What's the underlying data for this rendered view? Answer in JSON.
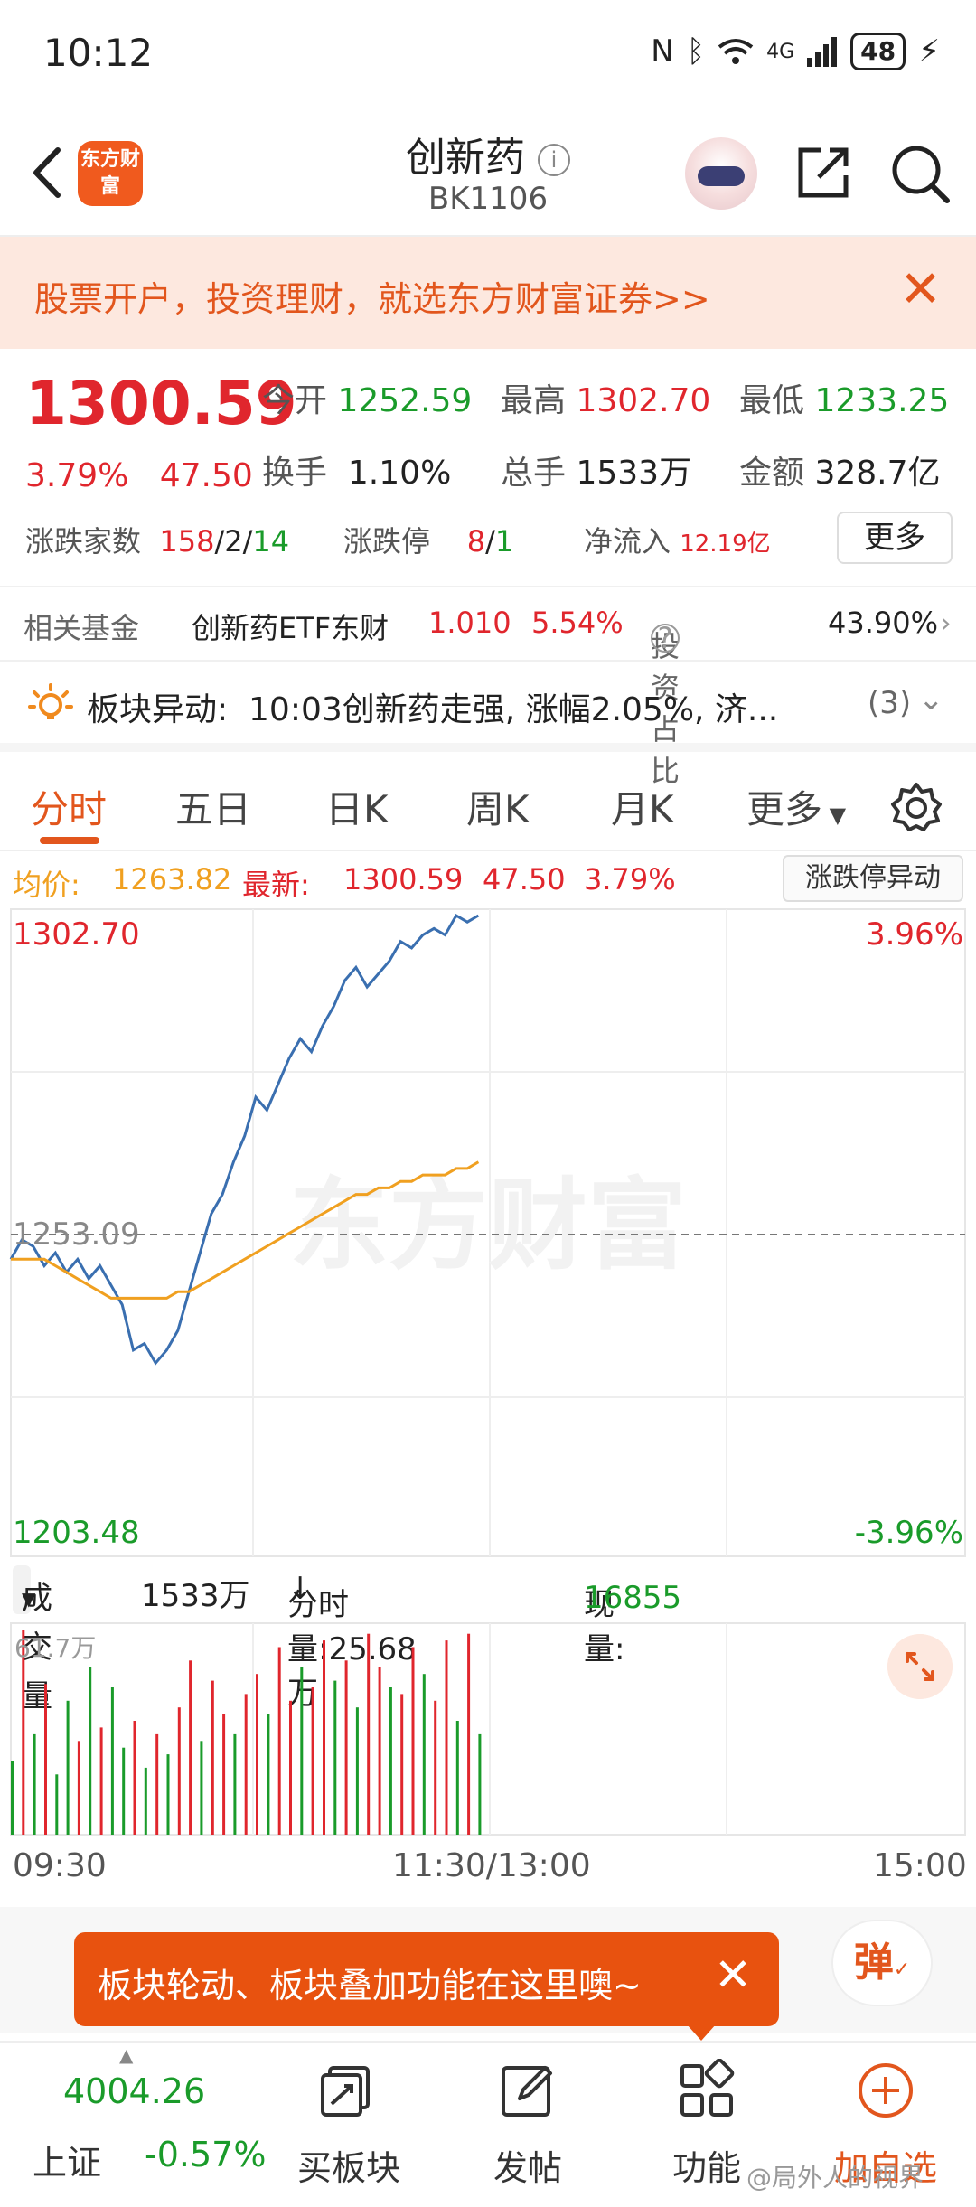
{
  "status_bar": {
    "time": "10:12",
    "network": "4G",
    "battery": "48"
  },
  "header": {
    "title": "创新药",
    "code": "BK1106",
    "logo_text": "东方财富"
  },
  "banner": {
    "text": "股票开户，投资理财，就选东方财富证券>>"
  },
  "quote": {
    "price": "1300.59",
    "change_pct": "3.79%",
    "change": "47.50",
    "open_label": "今开",
    "open": "1252.59",
    "high_label": "最高",
    "high": "1302.70",
    "low_label": "最低",
    "low": "1233.25",
    "turnover_label": "换手",
    "turnover": "1.10%",
    "volume_label": "总手",
    "volume": "1533万",
    "amount_label": "金额",
    "amount": "328.7亿",
    "breadth_label": "涨跌家数",
    "breadth_up": "158",
    "breadth_flat": "2",
    "breadth_down": "14",
    "limit_label": "涨跌停",
    "limit_up": "8",
    "limit_down": "1",
    "netflow_label": "净流入",
    "netflow": "12.19亿",
    "more_label": "更多"
  },
  "fund": {
    "label": "相关基金",
    "name": "创新药ETF东财",
    "price": "1.010",
    "change": "5.54%",
    "ratio_label": "投资占比",
    "ratio": "43.90%"
  },
  "news": {
    "label": "板块异动:",
    "text": "10:03创新药走强, 涨幅2.05%, 济...",
    "count": "(3)"
  },
  "tabs": [
    "分时",
    "五日",
    "日K",
    "周K",
    "月K",
    "更多"
  ],
  "info_row": {
    "avg_label": "均价:",
    "avg": "1263.82",
    "last_label": "最新:",
    "last": "1300.59",
    "change": "47.50",
    "change_pct": "3.79%",
    "button": "涨跌停异动"
  },
  "chart_data": {
    "type": "line",
    "x": [
      "09:30",
      "09:31",
      "09:32",
      "09:33",
      "09:34",
      "09:35",
      "09:36",
      "09:37",
      "09:38",
      "09:39",
      "09:40",
      "09:41",
      "09:42",
      "09:43",
      "09:44",
      "09:45",
      "09:46",
      "09:47",
      "09:48",
      "09:49",
      "09:50",
      "09:51",
      "09:52",
      "09:53",
      "09:54",
      "09:55",
      "09:56",
      "09:57",
      "09:58",
      "09:59",
      "10:00",
      "10:01",
      "10:02",
      "10:03",
      "10:04",
      "10:05",
      "10:06",
      "10:07",
      "10:08",
      "10:09",
      "10:10",
      "10:11",
      "10:12"
    ],
    "series": [
      {
        "name": "最新",
        "values": [
          1249,
          1252,
          1251,
          1248,
          1250,
          1247,
          1249,
          1246,
          1248,
          1245,
          1242,
          1235,
          1236,
          1233,
          1235,
          1238,
          1244,
          1250,
          1256,
          1259,
          1264,
          1268,
          1274,
          1272,
          1276,
          1280,
          1283,
          1281,
          1285,
          1288,
          1292,
          1294,
          1291,
          1293,
          1295,
          1298,
          1297,
          1299,
          1300,
          1299,
          1302,
          1301,
          1302
        ]
      },
      {
        "name": "均价",
        "values": [
          1249,
          1249,
          1249,
          1249,
          1248,
          1247,
          1246,
          1245,
          1244,
          1243,
          1243,
          1243,
          1243,
          1243,
          1243,
          1244,
          1244,
          1245,
          1246,
          1247,
          1248,
          1249,
          1250,
          1251,
          1252,
          1253,
          1254,
          1255,
          1256,
          1257,
          1258,
          1259,
          1259,
          1260,
          1260,
          1261,
          1261,
          1262,
          1262,
          1262,
          1263,
          1263,
          1264
        ]
      }
    ],
    "volume": [
      22,
      61,
      30,
      45,
      18,
      40,
      28,
      50,
      32,
      44,
      26,
      34,
      20,
      30,
      24,
      38,
      52,
      28,
      46,
      36,
      30,
      42,
      48,
      36,
      56,
      40,
      50,
      44,
      58,
      46,
      52,
      38,
      60,
      50,
      44,
      42,
      56,
      48,
      40,
      58,
      34,
      60,
      30
    ],
    "volume_colors": [
      "green",
      "red",
      "green",
      "red",
      "green",
      "green",
      "red",
      "green",
      "red",
      "green",
      "green",
      "red",
      "green",
      "red",
      "green",
      "red",
      "red",
      "green",
      "red",
      "red",
      "green",
      "red",
      "red",
      "green",
      "red",
      "red",
      "green",
      "red",
      "red",
      "green",
      "red",
      "green",
      "red",
      "red",
      "green",
      "red",
      "red",
      "green",
      "red",
      "red",
      "green",
      "red",
      "green"
    ],
    "ylim": [
      1203.48,
      1302.7
    ],
    "ref_price": "1253.09",
    "y_top_label": "1302.70",
    "y_bottom_label": "1203.48",
    "pct_top_label": "3.96%",
    "pct_bottom_label": "-3.96%",
    "x_labels": [
      "09:30",
      "11:30/13:00",
      "15:00"
    ],
    "watermark": "东方财富"
  },
  "volume_bar": {
    "selector": "成交量",
    "total": "1533万",
    "interval_label": "分时量:25.68万",
    "current_label": "现量:",
    "current": "16855",
    "max_label": "61.7万"
  },
  "tooltip": {
    "text": "板块轮动、板块叠加功能在这里噢~"
  },
  "danmu_label": "弹",
  "nav": {
    "index_value": "4004.26",
    "index_name": "上证",
    "index_change": "-0.57%",
    "items": [
      "买板块",
      "发帖",
      "功能",
      "加自选"
    ]
  },
  "watermark_text": "@局外人的视界"
}
